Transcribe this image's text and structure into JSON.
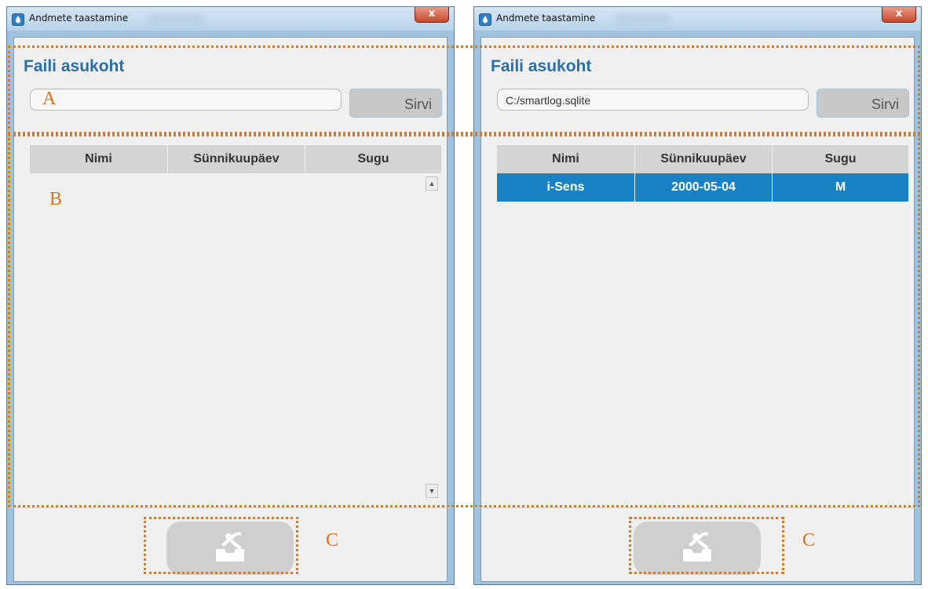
{
  "windows": [
    {
      "title": "Andmete taastamine",
      "close_glyph": "x",
      "section_title": "Faili asukoht",
      "file_path": "",
      "browse_label": "Sirvi",
      "columns": [
        "Nimi",
        "Sünnikuupäev",
        "Sugu"
      ],
      "rows": [],
      "restore_icon": "restore-tools-icon"
    },
    {
      "title": "Andmete taastamine",
      "close_glyph": "x",
      "section_title": "Faili asukoht",
      "file_path": "C:/smartlog.sqlite",
      "browse_label": "Sirvi",
      "columns": [
        "Nimi",
        "Sünnikuupäev",
        "Sugu"
      ],
      "rows": [
        {
          "name": "i-Sens",
          "birthdate": "2000-05-04",
          "gender": "M"
        }
      ],
      "restore_icon": "restore-tools-icon"
    }
  ],
  "annotations": {
    "a": "A",
    "b": "B",
    "c_left": "C",
    "c_right": "C"
  },
  "colors": {
    "accent": "#2a6fa8",
    "selected_row": "#1783c4",
    "annotation": "#e07a16"
  }
}
